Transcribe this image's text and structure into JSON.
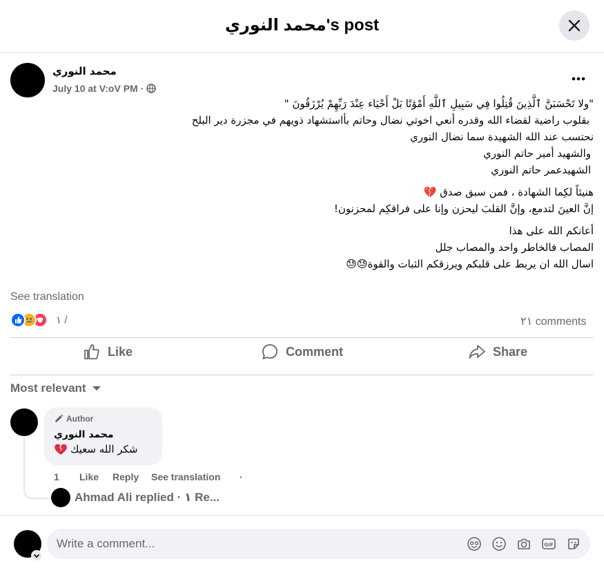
{
  "header": {
    "title": "محمد النوري's post"
  },
  "post": {
    "author": "محمد النوري",
    "timestamp": "July 10 at V:oV PM",
    "body_lines": [
      "\"ولا تَحْسَبَنَّ ٱلَّذِينَ قُتِلُوا فِي سَبِيلِ ٱللَّهِ أَمْوَٰتًا بَلْ أَحْيَاء عِنْدَ رَبِّهِمْ يُرْزَقُونَ \"",
      "بقلوب راضية لقضاء الله وقدره أنعي اخوتي نضال وحاتم بأاستشهاد ذويهم في مجزرة دير البلح",
      "نحتسب عند الله الشهيدة  سما نضال النوري",
      "والشهيد أمير حاتم النوري",
      "الشهيدعمر حاتم النوري",
      "هنيئاً لكِما  الشهادة ، فمن سبق صدق 💔",
      "إنَّ العينَ لتدمع، وإنَّ القلبَ ليحزن وإنا على فراقكِم لمحزنون!",
      "أعانكم الله على هذا",
      "المصاب فالخاطر واحد والمصاب جلل",
      "اسال الله ان يربط على قلبكم ويرزقكم الثبات والقوة😓😓"
    ],
    "see_translation": "See translation",
    "reaction_count": "١ /",
    "comments_count": "٢١ comments"
  },
  "actions": {
    "like": "Like",
    "comment": "Comment",
    "share": "Share"
  },
  "comments": {
    "sort_label": "Most relevant",
    "items": [
      {
        "badge": "Author",
        "name": "محمد النوري",
        "text": "شكر الله سعيك",
        "time": "1",
        "like": "Like",
        "reply": "Reply",
        "see_translation": "See translation",
        "dot": "·"
      }
    ],
    "reply_summary": "Ahmad Ali replied · ١ Re..."
  },
  "composer": {
    "placeholder": "Write a comment..."
  },
  "colors": {
    "like_blue": "#0866ff",
    "grey_text": "#65676b",
    "bubble_bg": "#f0f2f5",
    "heart_red": "#f33e58"
  }
}
